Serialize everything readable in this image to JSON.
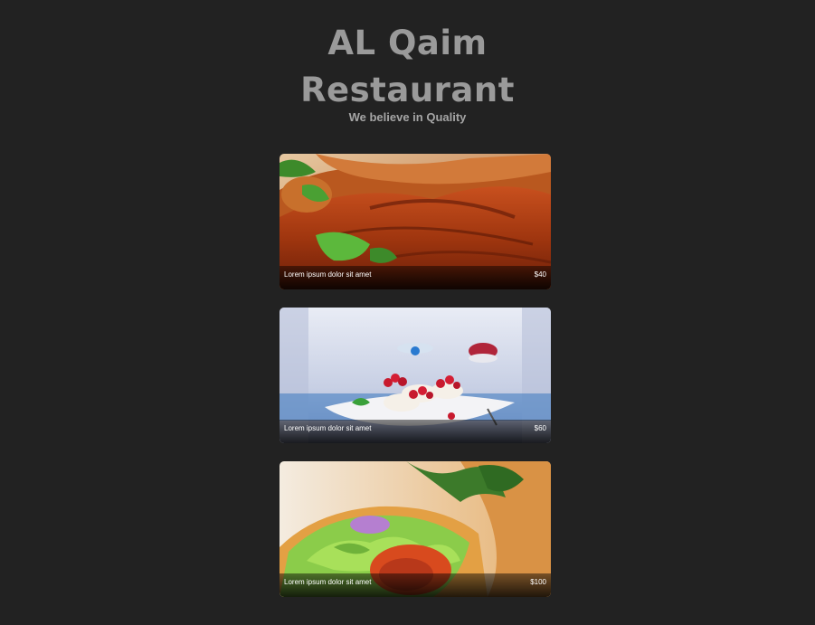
{
  "header": {
    "title_line1": "AL Qaim",
    "title_line2": "Restaurant",
    "tagline": "We believe in Quality"
  },
  "menu": {
    "items": [
      {
        "name": "Lorem ipsum dolor sit amet",
        "price": "$40",
        "image": "grilled-chicken-photo"
      },
      {
        "name": "Lorem ipsum dolor sit amet",
        "price": "$60",
        "image": "berry-dessert-photo"
      },
      {
        "name": "Lorem ipsum dolor sit amet",
        "price": "$100",
        "image": "salad-wrap-photo"
      }
    ]
  },
  "colors": {
    "background": "#222222",
    "title": "#9a9a9a",
    "tagline": "#a5a5a5",
    "caption_text": "#ffffff"
  }
}
